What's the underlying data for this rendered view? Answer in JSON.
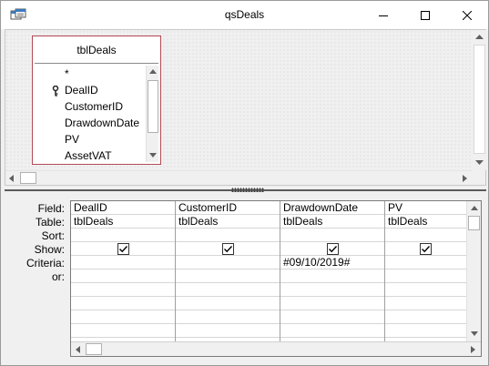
{
  "window": {
    "title": "qsDeals"
  },
  "icons": {
    "app": "query-icon",
    "minimize": "minimize-icon",
    "maximize": "maximize-icon",
    "close": "close-icon",
    "key": "primary-key-icon"
  },
  "table_box": {
    "title": "tblDeals",
    "fields": [
      "*",
      "DealID",
      "CustomerID",
      "DrawdownDate",
      "PV",
      "AssetVAT"
    ],
    "border_color": "#b24a55"
  },
  "grid": {
    "row_labels": [
      "Field:",
      "Table:",
      "Sort:",
      "Show:",
      "Criteria:",
      "or:"
    ],
    "columns": [
      {
        "field": "DealID",
        "table": "tblDeals",
        "sort": "",
        "show": true,
        "criteria": "",
        "or": ""
      },
      {
        "field": "CustomerID",
        "table": "tblDeals",
        "sort": "",
        "show": true,
        "criteria": "",
        "or": ""
      },
      {
        "field": "DrawdownDate",
        "table": "tblDeals",
        "sort": "",
        "show": true,
        "criteria": "#09/10/2019#",
        "or": ""
      },
      {
        "field": "PV",
        "table": "tblDeals",
        "sort": "",
        "show": true,
        "criteria": "",
        "or": ""
      }
    ]
  }
}
